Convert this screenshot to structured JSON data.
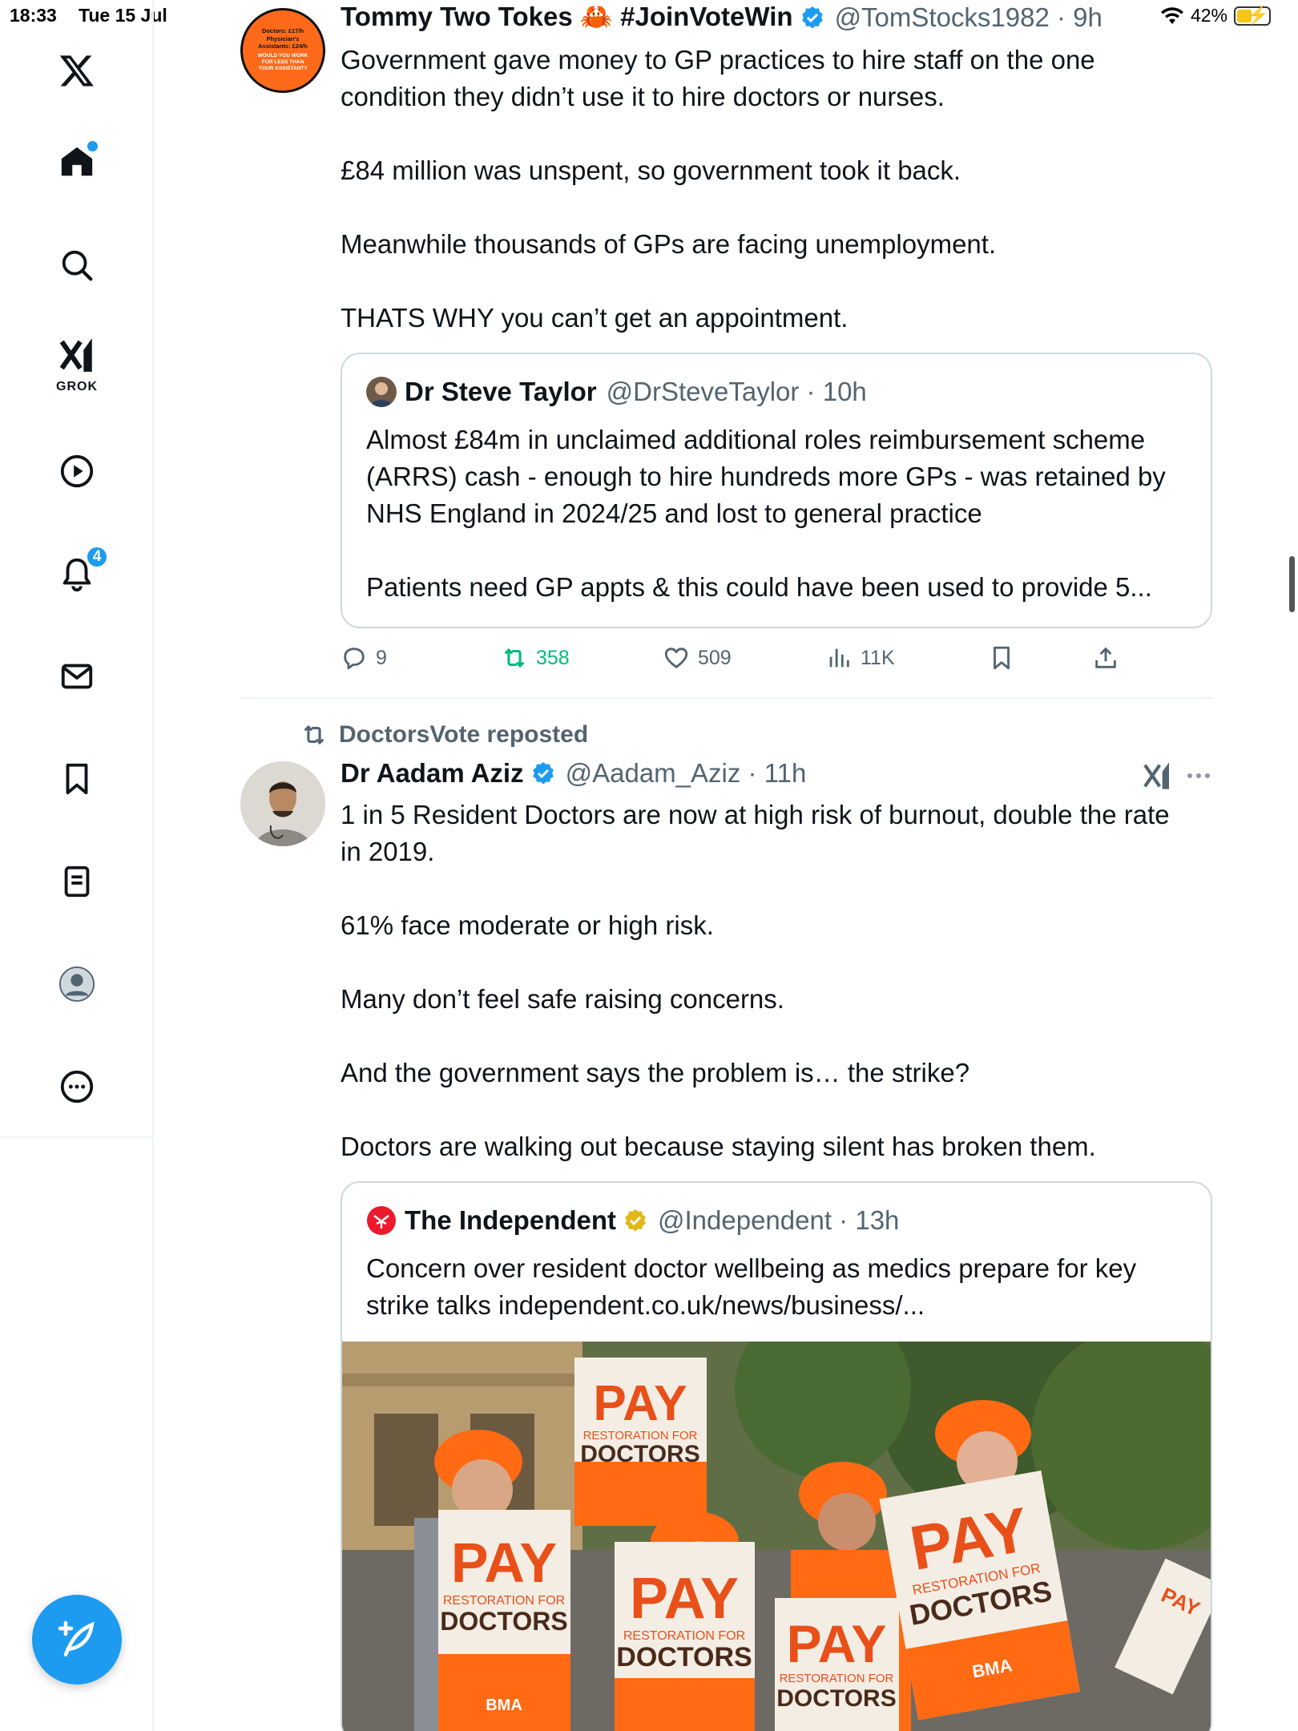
{
  "status_bar": {
    "time": "18:33",
    "date": "Tue 15 Jul",
    "battery": "42%"
  },
  "nav": {
    "notifications_badge": "4",
    "grok_label": "GROK"
  },
  "tweet1": {
    "avatar_text": "Doctors: £17/h Physician's Assistants: £24/h WOULD YOU WORK FOR LESS THAN YOUR ASSISTANT?",
    "name": "Tommy Two Tokes 🦀 #JoinVoteWin",
    "handle": "@TomStocks1982 · 9h",
    "text": "Government gave money to GP practices to hire staff on the one\ncondition they didn’t use it to hire doctors or nurses.\n\n£84 million was unspent, so government took it back.\n\nMeanwhile thousands of GPs are facing unemployment.\n\nTHATS WHY you can’t get an appointment.",
    "quote": {
      "name": "Dr Steve Taylor",
      "handle": "@DrSteveTaylor · 10h",
      "text": "Almost £84m in unclaimed additional roles reimbursement scheme\n(ARRS) cash - enough to hire hundreds more GPs - was retained by\nNHS England in 2024/25 and lost to general practice\n\nPatients need GP appts & this could have been used to provide 5..."
    },
    "actions": {
      "replies": "9",
      "reposts": "358",
      "likes": "509",
      "views": "11K"
    }
  },
  "tweet2": {
    "reposted_by": "DoctorsVote reposted",
    "name": "Dr Aadam Aziz",
    "handle": "@Aadam_Aziz · 11h",
    "text": "1 in 5 Resident Doctors are now at high risk of burnout, double the rate\nin 2019.\n\n61% face moderate or high risk.\n\nMany don’t feel safe raising concerns.\n\nAnd the government says the problem is… the strike?\n\nDoctors are walking out because staying silent has broken them.",
    "quote": {
      "name": "The Independent",
      "handle": "@Independent · 13h",
      "text": "Concern over resident doctor wellbeing as medics prepare for key\nstrike talks independent.co.uk/news/business/..."
    },
    "photo_signs": [
      "PAY",
      "RESTORATION FOR",
      "DOCTORS",
      "BMA"
    ]
  }
}
